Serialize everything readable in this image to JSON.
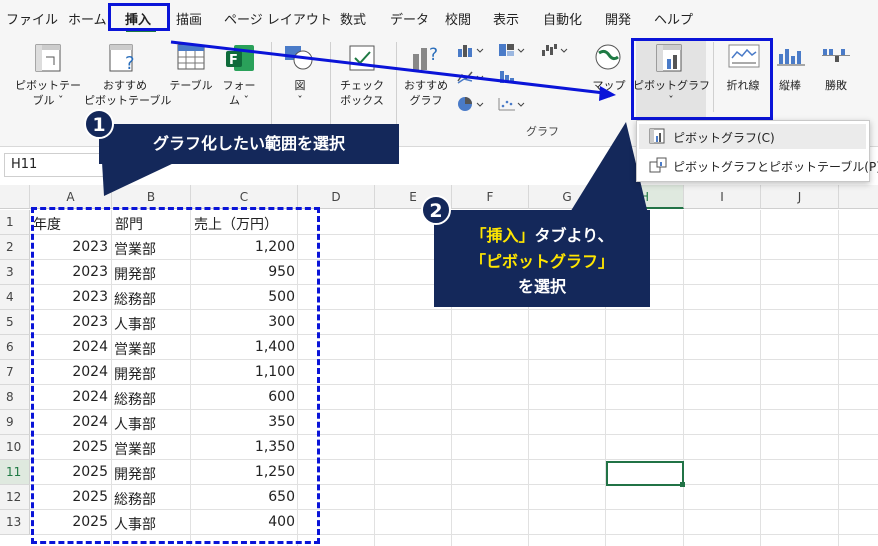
{
  "menu": {
    "items": [
      "ファイル",
      "ホーム",
      "挿入",
      "描画",
      "ページ レイアウト",
      "数式",
      "データ",
      "校閲",
      "表示",
      "自動化",
      "開発",
      "ヘルプ"
    ],
    "active": "挿入"
  },
  "ribbon": {
    "pivot_table": "ピボットテー\nブル ˇ",
    "recommended_pivot": "おすすめ\nピボットテーブル",
    "table": "テーブル",
    "forms": "フォー\nム ˇ",
    "illustrations": "図\nˇ",
    "checkbox": "チェック\nボックス",
    "recommended_charts": "おすすめ\nグラフ",
    "maps": "マップ\nˇ",
    "pivot_chart": "ピボットグラフ\nˇ",
    "sparkline_line": "折れ線",
    "sparkline_column": "縦棒",
    "sparkline_winloss": "勝敗",
    "charts_group_label": "グラフ"
  },
  "dropdown": {
    "items": [
      "ピボットグラフ(C)",
      "ピボットグラフとピボットテーブル(P)"
    ]
  },
  "name_box": "H11",
  "columns": [
    "A",
    "B",
    "C",
    "D",
    "E",
    "F",
    "G",
    "H",
    "I",
    "J"
  ],
  "sheet": {
    "headers": [
      "年度",
      "部門",
      "売上（万円）"
    ],
    "rows": [
      [
        "2023",
        "営業部",
        "1,200"
      ],
      [
        "2023",
        "開発部",
        "950"
      ],
      [
        "2023",
        "総務部",
        "500"
      ],
      [
        "2023",
        "人事部",
        "300"
      ],
      [
        "2024",
        "営業部",
        "1,400"
      ],
      [
        "2024",
        "開発部",
        "1,100"
      ],
      [
        "2024",
        "総務部",
        "600"
      ],
      [
        "2024",
        "人事部",
        "350"
      ],
      [
        "2025",
        "営業部",
        "1,350"
      ],
      [
        "2025",
        "開発部",
        "1,250"
      ],
      [
        "2025",
        "総務部",
        "650"
      ],
      [
        "2025",
        "人事部",
        "400"
      ]
    ],
    "row_numbers": [
      "1",
      "2",
      "3",
      "4",
      "5",
      "6",
      "7",
      "8",
      "9",
      "10",
      "11",
      "12",
      "13"
    ]
  },
  "callouts": {
    "step1_badge": "1",
    "step1_text": "グラフ化したい範囲を選択",
    "step2_badge": "2",
    "step2_line1_em": "「挿入」",
    "step2_line1_rest": "タブより、",
    "step2_line2": "「ピボットグラフ」",
    "step2_line3": "を選択"
  },
  "colors": {
    "highlight_blue": "#0a14d8",
    "callout_navy": "#14285a",
    "callout_yellow": "#ffe600",
    "excel_green": "#1f7a44",
    "selection_green": "#217346"
  }
}
